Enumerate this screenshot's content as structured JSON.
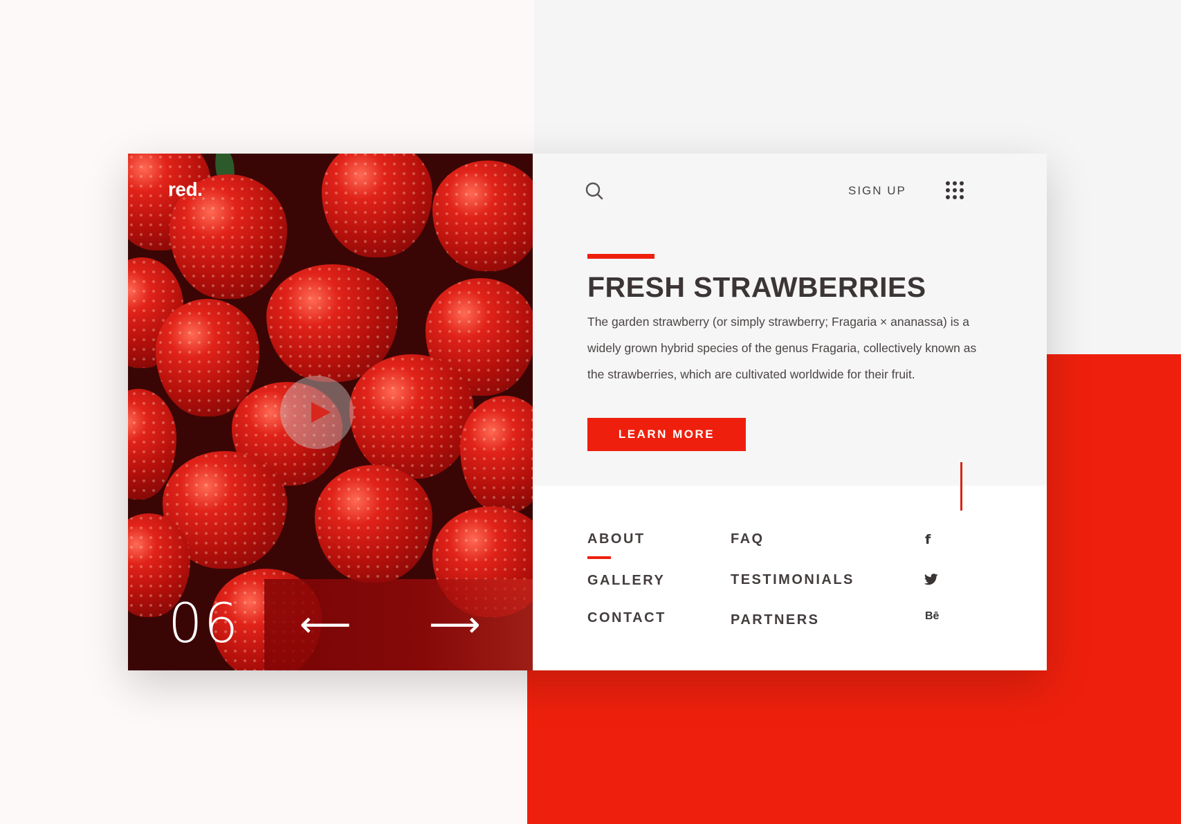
{
  "brand": {
    "logo": "red."
  },
  "slider": {
    "counter": "06",
    "prev_label": "⟵",
    "next_label": "⟶"
  },
  "header": {
    "signup_label": "SIGN UP"
  },
  "hero": {
    "title": "FRESH STRAWBERRIES",
    "description": "The garden strawberry (or simply strawberry; Fragaria × ananassa) is a widely grown hybrid species of the genus Fragaria, collectively known as the strawberries, which are cultivated worldwide for their fruit.",
    "cta_label": "LEARN MORE"
  },
  "footer_nav": {
    "col1": [
      "ABOUT",
      "GALLERY",
      "CONTACT"
    ],
    "col2": [
      "FAQ",
      "TESTIMONIALS",
      "PARTNERS"
    ]
  },
  "social": {
    "facebook": "f",
    "twitter": "🐦",
    "behance": "Bē"
  },
  "colors": {
    "accent": "#ee200d",
    "text_dark": "#3c3535",
    "panel_bg": "#f6f6f6"
  }
}
